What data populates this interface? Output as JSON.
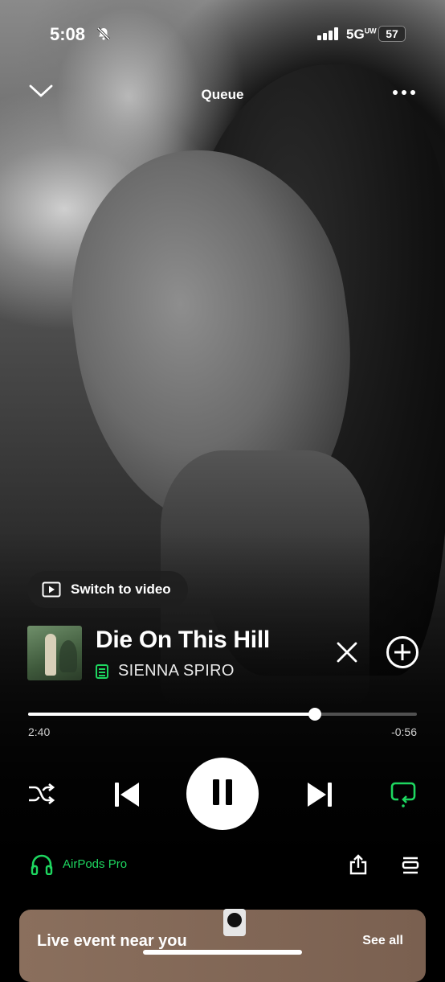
{
  "status_bar": {
    "time": "5:08",
    "network": "5G",
    "network_suffix": "UW",
    "battery": "57"
  },
  "header": {
    "title": "Queue"
  },
  "video_toggle": {
    "label": "Switch to video"
  },
  "track": {
    "title": "Die On This Hill",
    "artist": "SIENNA SPIRO"
  },
  "playback": {
    "elapsed": "2:40",
    "remaining": "-0:56",
    "progress": 0.737
  },
  "device": {
    "name": "AirPods Pro"
  },
  "live_event": {
    "title": "Live event near you",
    "see_all": "See all"
  },
  "colors": {
    "accent": "#1ed760",
    "background": "#000000",
    "card": "#7f6655"
  },
  "icons": [
    "bell-slash-icon",
    "signal-icon",
    "chevron-down-icon",
    "more-icon",
    "video-icon",
    "lyrics-icon",
    "close-icon",
    "add-icon",
    "shuffle-icon",
    "previous-icon",
    "pause-icon",
    "next-icon",
    "repeat-icon",
    "headphones-icon",
    "share-icon",
    "queue-icon"
  ]
}
